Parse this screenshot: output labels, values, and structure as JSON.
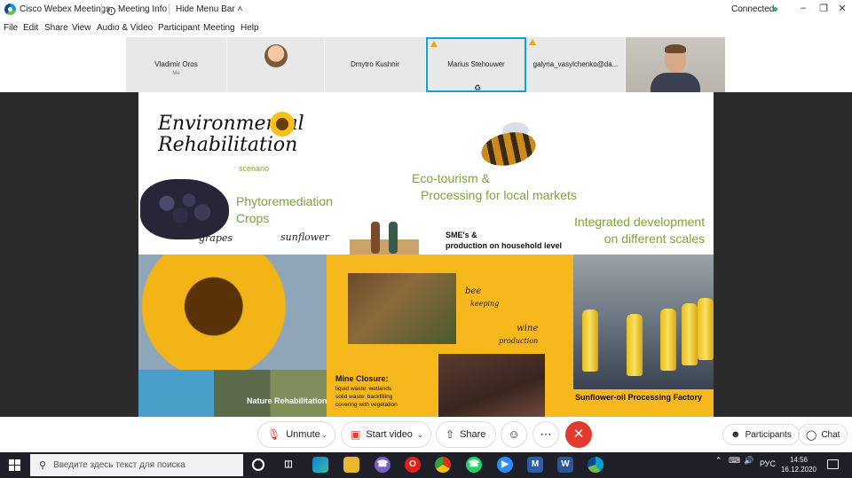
{
  "titlebar": {
    "app_name": "Cisco Webex Meetings",
    "meeting_info": "Meeting Info",
    "hide_menu_bar": "Hide Menu Bar ˄",
    "connection_status": "Connected",
    "status_color": "#2bb673"
  },
  "menu": {
    "items": [
      "File",
      "Edit",
      "Share",
      "View",
      "Audio & Video",
      "Participant",
      "Meeting",
      "Help"
    ]
  },
  "participants": [
    {
      "name": "Vladimir Oros",
      "sub": "Me"
    },
    {
      "name": ""
    },
    {
      "name": "Dmytro Kushnir"
    },
    {
      "name": "Marius Stehouwer"
    },
    {
      "name": "galyna_vasylchenko@da..."
    }
  ],
  "slide": {
    "title_line1": "Environmental",
    "title_line2": "Rehabilitation",
    "scenario": "scenario",
    "phyto_line1": "Phytoremediation",
    "phyto_line2": "Crops",
    "grapes": "grapes",
    "sunflower": "sunflower",
    "eco_line1": "Eco-tourism &",
    "eco_line2": "Processing for local markets",
    "sme_line1": "SME's &",
    "sme_line2": "production on household level",
    "integrated_line1": "Integrated development",
    "integrated_line2": "on different scales",
    "bee_line1": "bee",
    "bee_line2": "keeping",
    "wine_line1": "wine",
    "wine_line2": "production",
    "mine_title": "Mine Closure:",
    "mine_line1": "liquid waste: wetlands",
    "mine_line2": "solid waste: backfilling",
    "mine_line3": "covering with vegetation",
    "nature": "Nature Rehabilitation",
    "factory": "Sunflower-oil Processing Factory",
    "accent_green": "#7ea33a",
    "accent_yellow": "#f6b81c"
  },
  "controls": {
    "unmute": "Unmute",
    "start_video": "Start video",
    "share": "Share",
    "participants": "Participants",
    "chat": "Chat",
    "end_color": "#e33b2f"
  },
  "taskbar": {
    "search_placeholder": "Введите здесь текст для поиска",
    "language": "РУС",
    "time": "14:56",
    "date": "16.12.2020"
  }
}
